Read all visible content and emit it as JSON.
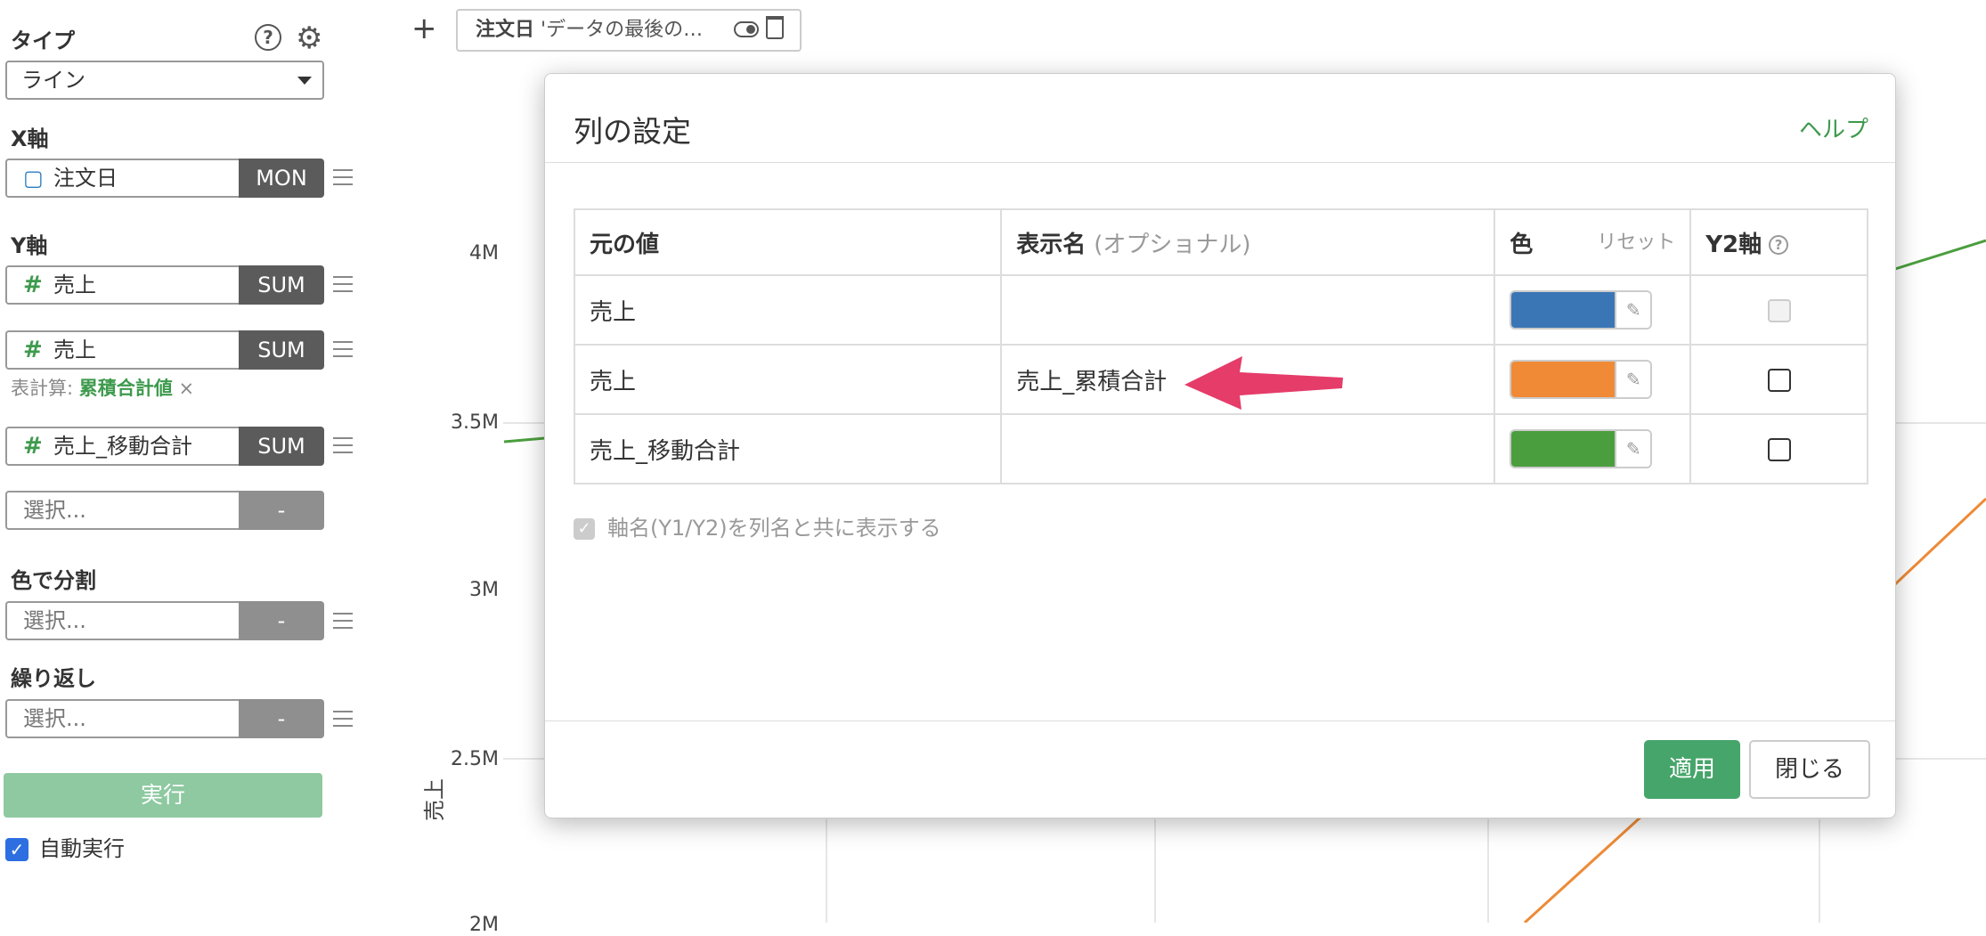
{
  "sidebar": {
    "type_label": "タイプ",
    "type_value": "ライン",
    "x_axis_label": "X軸",
    "x_field": {
      "name": "注文日",
      "agg": "MON"
    },
    "y_axis_label": "Y軸",
    "y_fields": [
      {
        "name": "売上",
        "agg": "SUM"
      },
      {
        "name": "売上",
        "agg": "SUM"
      },
      {
        "name": "売上_移動合計",
        "agg": "SUM"
      }
    ],
    "table_calc_prefix": "表計算:",
    "table_calc_value": "累積合計値",
    "table_calc_remove": "×",
    "y_placeholder": "選択...",
    "y_placeholder_agg": "-",
    "color_split_label": "色で分割",
    "color_split_placeholder": "選択...",
    "color_split_agg": "-",
    "repeat_label": "繰り返し",
    "repeat_placeholder": "選択...",
    "repeat_agg": "-",
    "run_label": "実行",
    "auto_run_label": "自動実行",
    "help_icon": "?"
  },
  "filter": {
    "field": "注文日",
    "text": "'データの最後の…"
  },
  "chart": {
    "y_ticks": [
      "4M",
      "3.5M",
      "3M",
      "2.5M",
      "2M"
    ],
    "y_axis_title": "売上",
    "colors": {
      "green": "#4b9e3e",
      "orange": "#ee8a36"
    }
  },
  "modal": {
    "title": "列の設定",
    "help": "ヘルプ",
    "headers": {
      "original": "元の値",
      "display": "表示名",
      "display_optional": "(オプショナル)",
      "color": "色",
      "reset": "リセット",
      "y2": "Y2軸"
    },
    "rows": [
      {
        "original": "売上",
        "display": "",
        "color": "#3a76b5",
        "y2_disabled": true
      },
      {
        "original": "売上",
        "display": "売上_累積合計",
        "color": "#f08a36",
        "y2_disabled": false
      },
      {
        "original": "売上_移動合計",
        "display": "",
        "color": "#4b9e3e",
        "y2_disabled": false
      }
    ],
    "axis_name_option": "軸名(Y1/Y2)を列名と共に表示する",
    "apply": "適用",
    "close": "閉じる"
  },
  "annotation": {
    "arrow_color": "#e53c6a"
  }
}
